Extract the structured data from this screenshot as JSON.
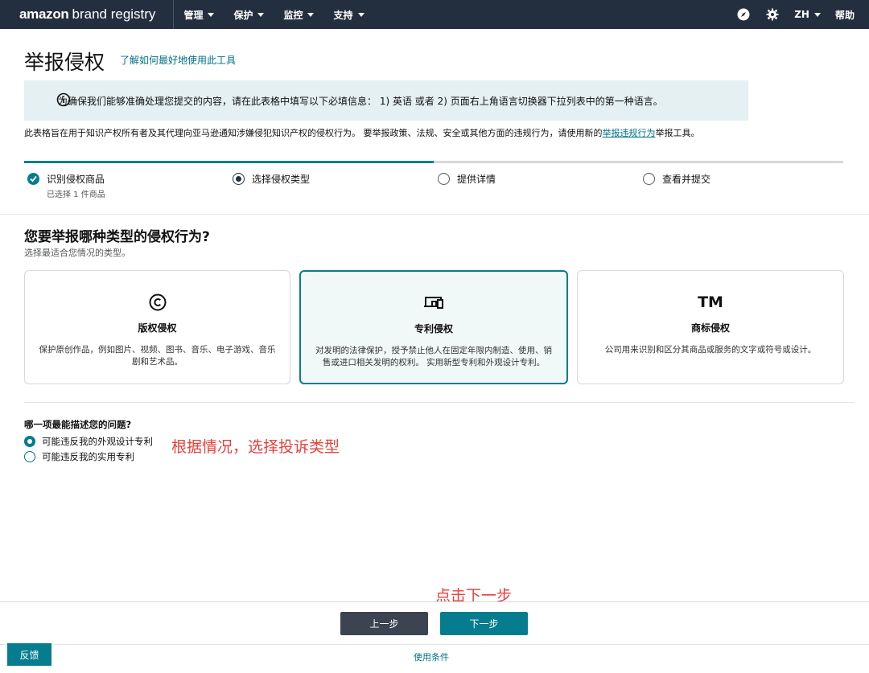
{
  "nav": {
    "logo_bold": "amazon",
    "logo_rest": "brand registry",
    "menu": [
      "管理",
      "保护",
      "监控",
      "支持"
    ],
    "lang": "ZH",
    "help": "帮助",
    "icons": [
      "compass-icon",
      "gear-icon"
    ]
  },
  "page": {
    "title": "举报侵权",
    "title_link": "了解如何最好地使用此工具",
    "banner": "为确保我们能够准确处理您提交的内容，请在此表格中填写以下必填信息： 1) 英语 或者 2) 页面右上角语言切换器下拉列表中的第一种语言。",
    "desc_before": "此表格旨在用于知识产权所有者及其代理向亚马逊通知涉嫌侵犯知识产权的侵权行为。 要举报政策、法规、安全或其他方面的违规行为，请使用新的",
    "desc_link": "举报违规行为",
    "desc_after": "举报工具。"
  },
  "steps": [
    {
      "label": "识别侵权商品",
      "sub": "已选择 1 件商品",
      "state": "done"
    },
    {
      "label": "选择侵权类型",
      "sub": "",
      "state": "current"
    },
    {
      "label": "提供详情",
      "sub": "",
      "state": "todo"
    },
    {
      "label": "查看并提交",
      "sub": "",
      "state": "todo"
    }
  ],
  "progress_fraction": 0.5,
  "question": {
    "title": "您要举报哪种类型的侵权行为?",
    "subtitle": "选择最适合您情况的类型。"
  },
  "cards": [
    {
      "icon": "©",
      "name": "版权侵权",
      "desc": "保护原创作品，例如图片、视频、图书、音乐、电子游戏、音乐剧和艺术品。",
      "selected": false
    },
    {
      "icon": "patent-icon",
      "name": "专利侵权",
      "desc": "对发明的法律保护，授予禁止他人在固定年限内制造、使用、销售或进口相关发明的权利。 实用新型专利和外观设计专利。",
      "selected": true
    },
    {
      "icon": "TM",
      "name": "商标侵权",
      "desc": "公司用来识别和区分其商品或服务的文字或符号或设计。",
      "selected": false
    }
  ],
  "sub_question": {
    "title": "哪一项最能描述您的问题?",
    "options": [
      {
        "label": "可能违反我的外观设计专利",
        "checked": true
      },
      {
        "label": "可能违反我的实用专利",
        "checked": false
      }
    ]
  },
  "annotations": {
    "choose_type": "根据情况，选择投诉类型",
    "click_next": "点击下一步"
  },
  "footer": {
    "prev": "上一步",
    "next": "下一步",
    "feedback": "反馈",
    "terms": "使用条件"
  },
  "colors": {
    "nav_bg": "#232f3e",
    "accent": "#067d8e",
    "link": "#007185",
    "banner_bg": "#e4f0f1",
    "annotation": "#e8403c"
  }
}
